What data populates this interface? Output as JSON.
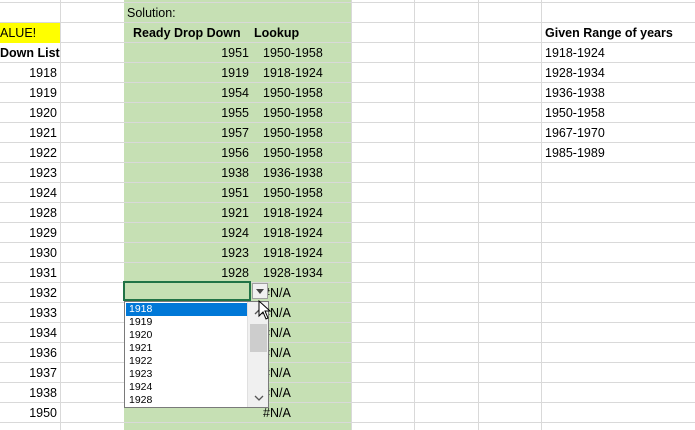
{
  "colA": {
    "header": "ALUE!",
    "header2": "Down List",
    "years": [
      "1918",
      "1919",
      "1920",
      "1921",
      "1922",
      "1923",
      "1924",
      "1928",
      "1929",
      "1930",
      "1931",
      "1932",
      "1933",
      "1934",
      "1936",
      "1937",
      "1938",
      "1950"
    ]
  },
  "solution": {
    "label": "Solution:",
    "col_ready": "Ready Drop Down",
    "col_lookup": "Lookup",
    "rows": [
      {
        "year": "1951",
        "range": "1950-1958"
      },
      {
        "year": "1919",
        "range": "1918-1924"
      },
      {
        "year": "1954",
        "range": "1950-1958"
      },
      {
        "year": "1955",
        "range": "1950-1958"
      },
      {
        "year": "1957",
        "range": "1950-1958"
      },
      {
        "year": "1956",
        "range": "1950-1958"
      },
      {
        "year": "1938",
        "range": "1936-1938"
      },
      {
        "year": "1951",
        "range": "1950-1958"
      },
      {
        "year": "1921",
        "range": "1918-1924"
      },
      {
        "year": "1924",
        "range": "1918-1924"
      },
      {
        "year": "1923",
        "range": "1918-1924"
      },
      {
        "year": "1928",
        "range": "1928-1934"
      }
    ],
    "na": [
      "#N/A",
      "#N/A",
      "#N/A",
      "#N/A",
      "#N/A",
      "#N/A",
      "#N/A"
    ]
  },
  "given": {
    "header": "Given Range of years",
    "ranges": [
      "1918-1924",
      "1928-1934",
      "1936-1938",
      "1950-1958",
      "1967-1970",
      "1985-1989"
    ]
  },
  "dropdown": {
    "selected": "1918",
    "options": [
      "1918",
      "1919",
      "1920",
      "1921",
      "1922",
      "1923",
      "1924",
      "1928"
    ]
  },
  "icons": {
    "dropdown_arrow": "chevron-down-icon",
    "scroll_up": "chevron-up-icon",
    "scroll_down": "chevron-down-icon",
    "cursor": "mouse-pointer-icon"
  },
  "colors": {
    "solution_fill": "#c6e0b4",
    "header_highlight": "#ffff00",
    "selected_option": "#0078d7",
    "active_cell_border": "#217346"
  }
}
